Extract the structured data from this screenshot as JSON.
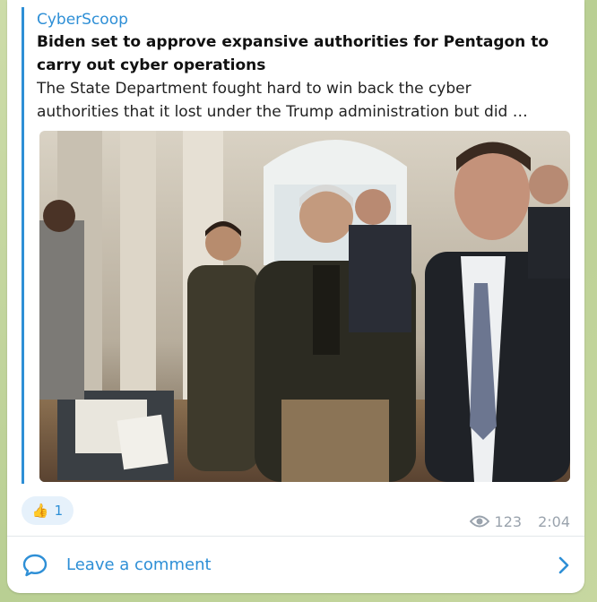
{
  "preview": {
    "site_name": "CyberScoop",
    "title": "Biden set to approve expansive authorities for Pentagon to carry out cyber operations",
    "description_line1": "The State Department fought hard to win back the cyber",
    "description_line2": "authorities that it lost under the Trump administration but did …"
  },
  "reaction": {
    "emoji": "👍",
    "count": "1"
  },
  "meta": {
    "views": "123",
    "time": "2:04"
  },
  "comment": {
    "label": "Leave a comment"
  },
  "colors": {
    "accent": "#2e8fd6",
    "bubble": "#ffffff",
    "background": "#c9d8a4",
    "meta_text": "#9aa3ad"
  },
  "icons": {
    "views": "eye-icon",
    "comment": "speech-bubble-icon",
    "chevron": "chevron-right-icon"
  }
}
